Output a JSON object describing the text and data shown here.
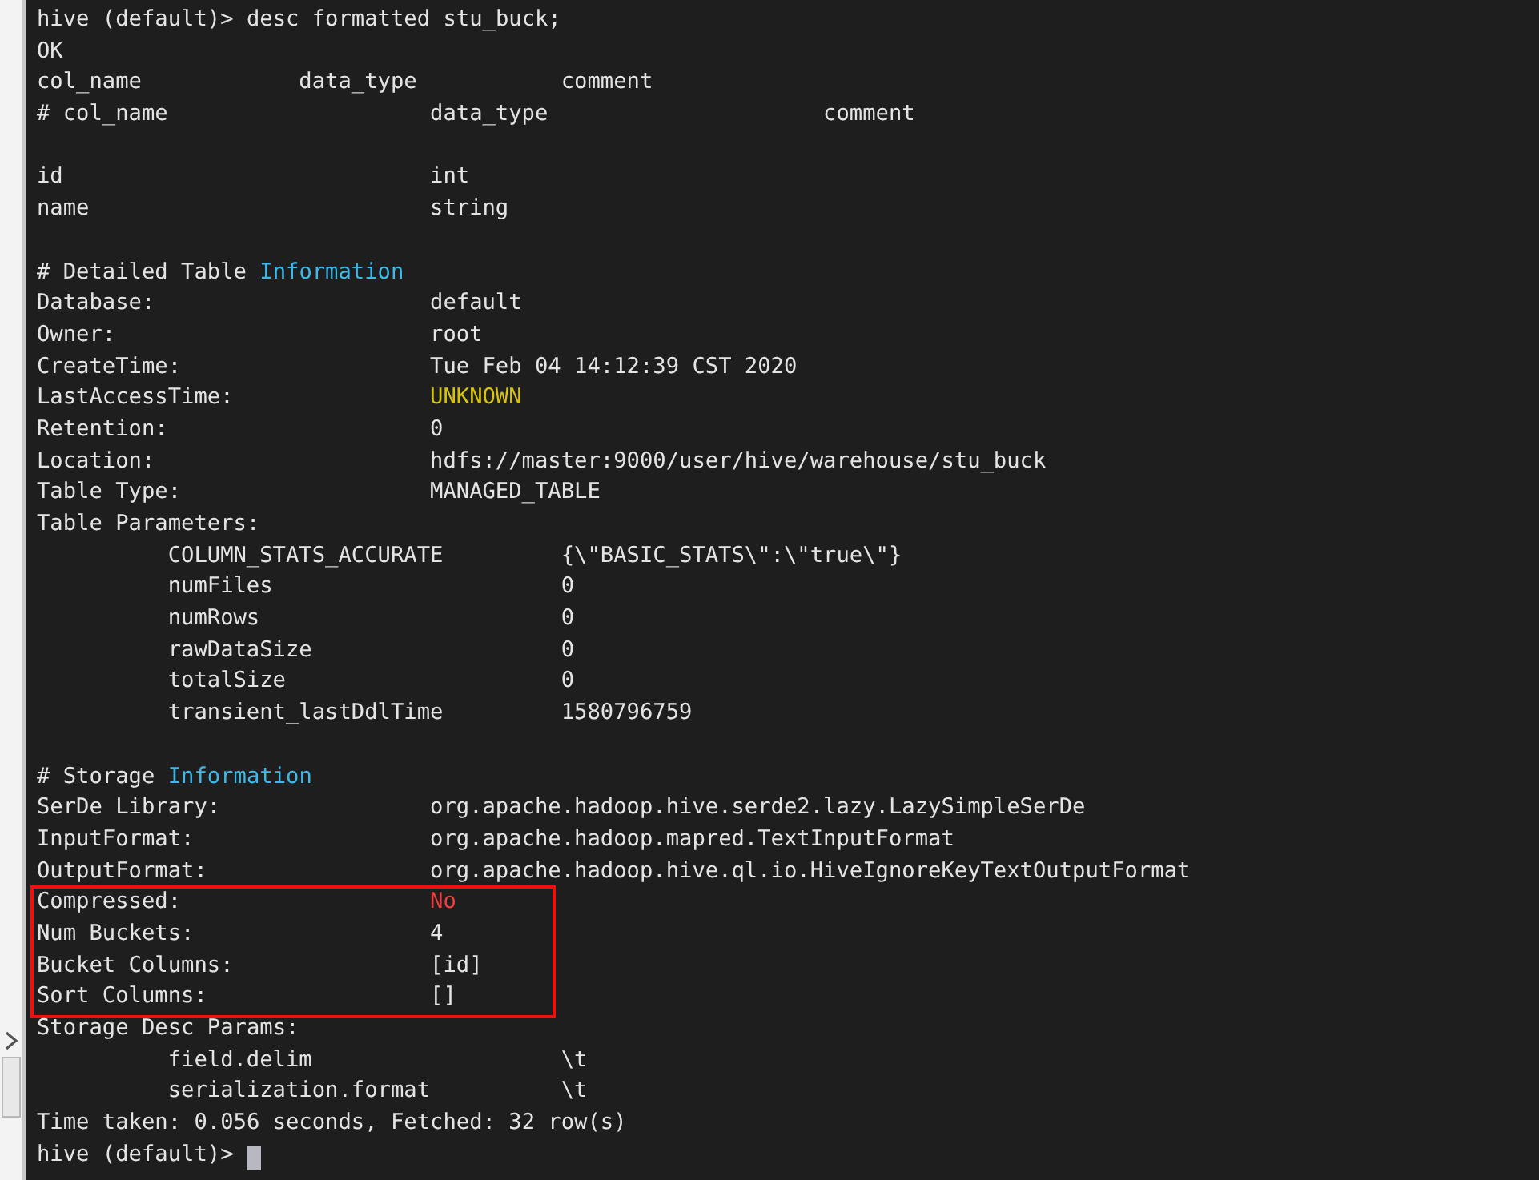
{
  "terminal": {
    "blocks": [
      {
        "highlighted": false,
        "lines": [
          {
            "kind": "text",
            "text": "hive (default)> desc formatted stu_buck;"
          },
          {
            "kind": "text",
            "text": "OK"
          },
          {
            "kind": "columns",
            "cells": [
              "col_name",
              "data_type",
              "comment"
            ]
          },
          {
            "kind": "columns_wide",
            "cells": [
              "# col_name",
              "data_type",
              "comment"
            ]
          },
          {
            "kind": "blank"
          },
          {
            "kind": "field",
            "key": "id",
            "value": "int"
          },
          {
            "kind": "field",
            "key": "name",
            "value": "string"
          },
          {
            "kind": "blank"
          },
          {
            "kind": "heading",
            "text": "# Detailed Table",
            "keyword": "Information",
            "color": "#3cb9e8"
          },
          {
            "kind": "field",
            "key": "Database:",
            "value": "default"
          },
          {
            "kind": "field",
            "key": "Owner:",
            "value": "root"
          },
          {
            "kind": "field",
            "key": "CreateTime:",
            "value": "Tue Feb 04 14:12:39 CST 2020"
          },
          {
            "kind": "field",
            "key": "LastAccessTime:",
            "value": "UNKNOWN",
            "color": "#d8c40c"
          },
          {
            "kind": "field",
            "key": "Retention:",
            "value": "0"
          },
          {
            "kind": "field",
            "key": "Location:",
            "value": "hdfs://master:9000/user/hive/warehouse/stu_buck"
          },
          {
            "kind": "field",
            "key": "Table Type:",
            "value": "MANAGED_TABLE"
          },
          {
            "kind": "text",
            "text": "Table Parameters:"
          },
          {
            "kind": "param",
            "key": "COLUMN_STATS_ACCURATE",
            "value": "{\\\"BASIC_STATS\\\":\\\"true\\\"}"
          },
          {
            "kind": "param",
            "key": "numFiles",
            "value": "0"
          },
          {
            "kind": "param",
            "key": "numRows",
            "value": "0"
          },
          {
            "kind": "param",
            "key": "rawDataSize",
            "value": "0"
          },
          {
            "kind": "param",
            "key": "totalSize",
            "value": "0"
          },
          {
            "kind": "param",
            "key": "transient_lastDdlTime",
            "value": "1580796759"
          },
          {
            "kind": "blank"
          },
          {
            "kind": "heading",
            "text": "# Storage",
            "keyword": "Information",
            "color": "#3cb9e8"
          },
          {
            "kind": "field",
            "key": "SerDe Library:",
            "value": "org.apache.hadoop.hive.serde2.lazy.LazySimpleSerDe"
          },
          {
            "kind": "field",
            "key": "InputFormat:",
            "value": "org.apache.hadoop.mapred.TextInputFormat"
          },
          {
            "kind": "field",
            "key": "OutputFormat:",
            "value": "org.apache.hadoop.hive.ql.io.HiveIgnoreKeyTextOutputFormat"
          }
        ]
      },
      {
        "highlighted": true,
        "lines": [
          {
            "kind": "field",
            "key": "Compressed:",
            "value": "No",
            "color": "#e8413f"
          },
          {
            "kind": "field",
            "key": "Num Buckets:",
            "value": "4"
          },
          {
            "kind": "field",
            "key": "Bucket Columns:",
            "value": "[id]"
          },
          {
            "kind": "field",
            "key": "Sort Columns:",
            "value": "[]"
          }
        ]
      },
      {
        "highlighted": false,
        "lines": [
          {
            "kind": "text",
            "text": "Storage Desc Params:"
          },
          {
            "kind": "param",
            "key": "field.delim",
            "value": "\\t"
          },
          {
            "kind": "param",
            "key": "serialization.format",
            "value": "\\t"
          },
          {
            "kind": "text",
            "text": "Time taken: 0.056 seconds, Fetched: 32 row(s)"
          },
          {
            "kind": "prompt",
            "text": "hive (default)>",
            "cursor": true
          }
        ]
      }
    ]
  }
}
